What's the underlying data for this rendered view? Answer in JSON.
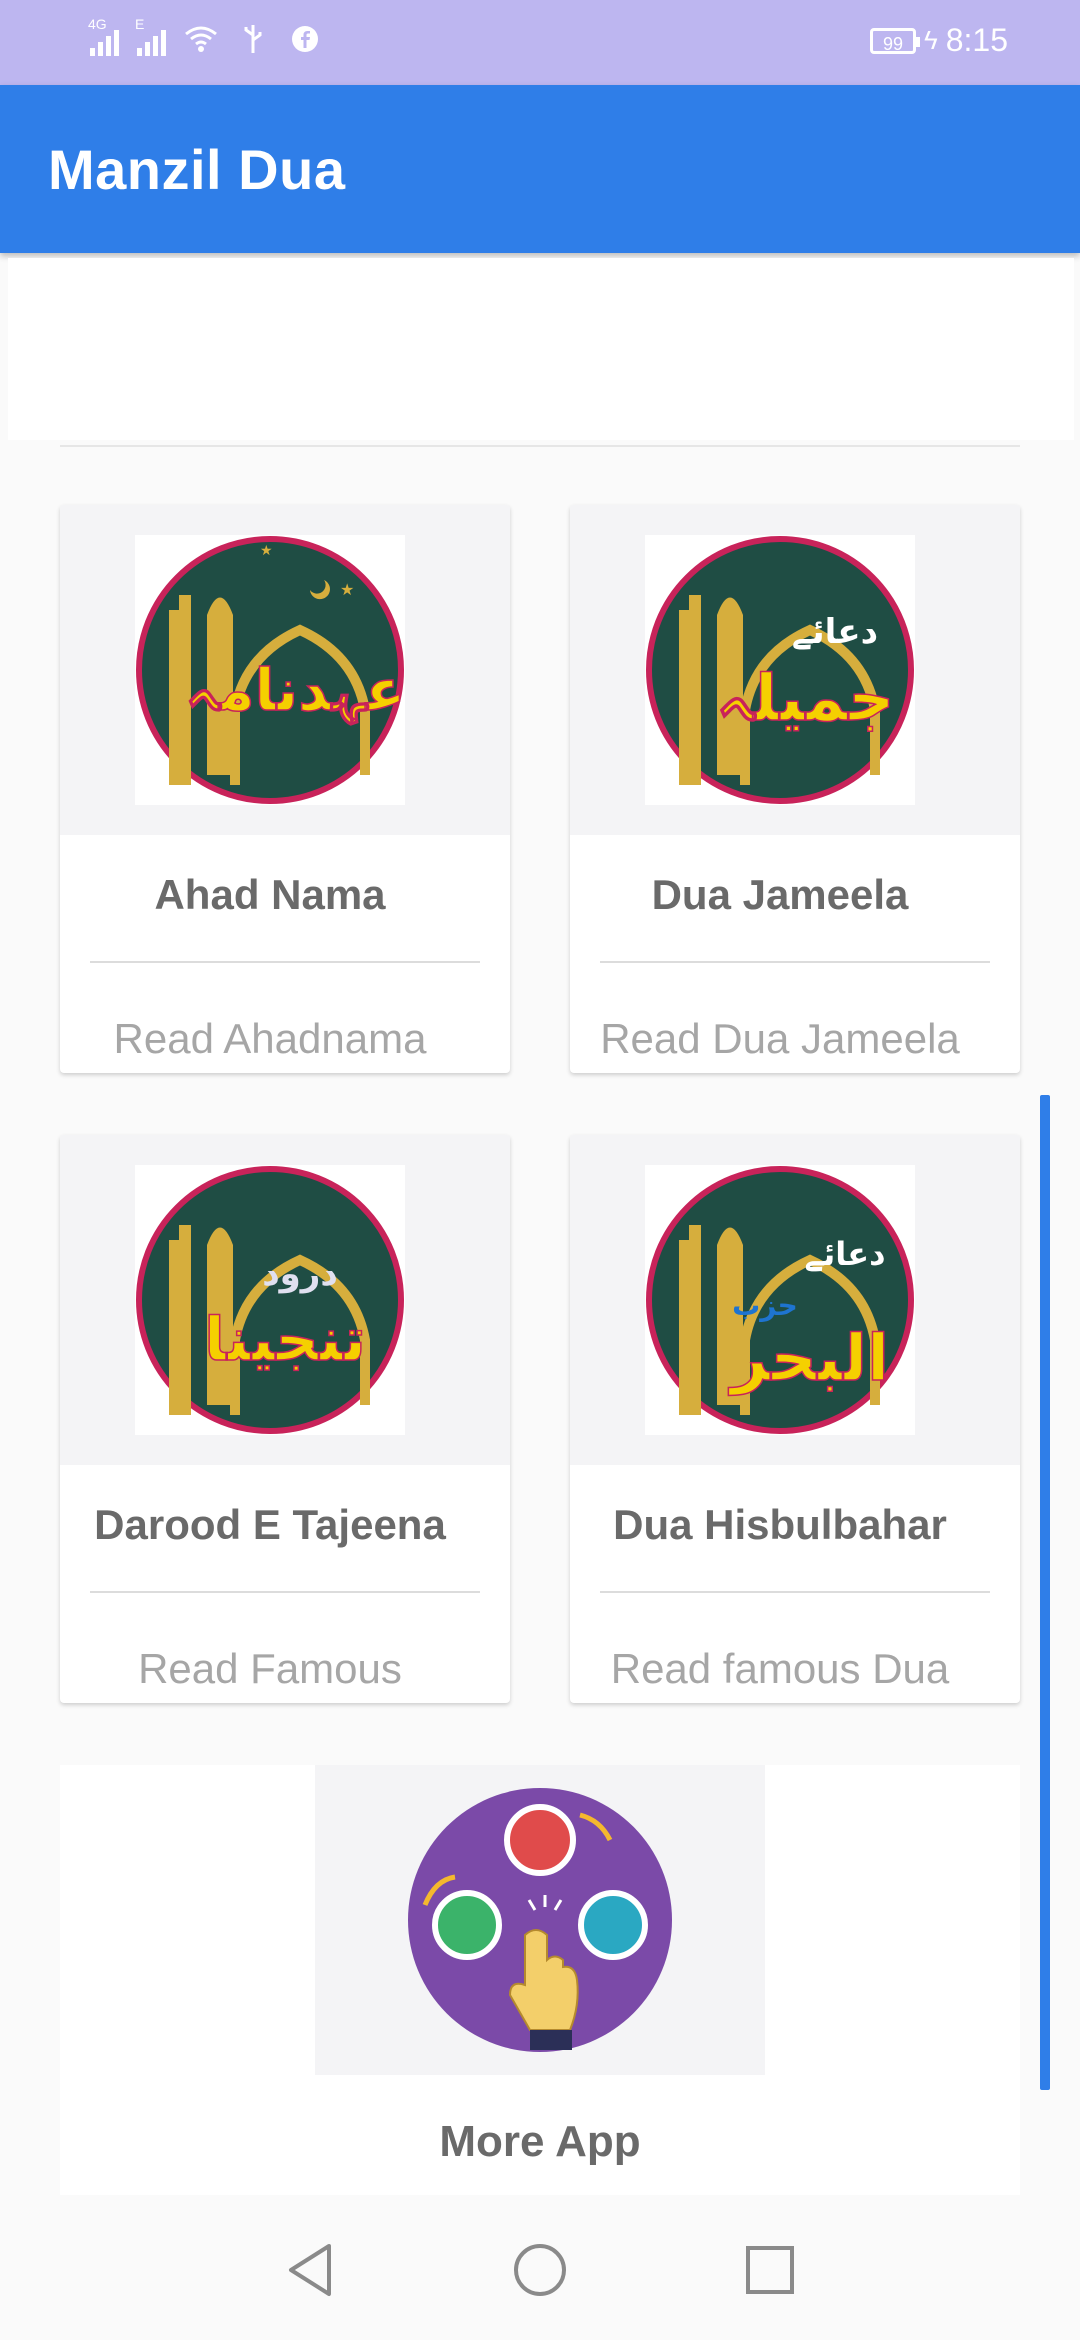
{
  "status_bar": {
    "network1": "4G",
    "network2": "E",
    "battery": "99",
    "time": "8:15",
    "icons": [
      "signal-icon",
      "signal-icon",
      "wifi-icon",
      "usb-icon",
      "facebook-icon",
      "battery-icon",
      "charging-icon"
    ]
  },
  "app_bar": {
    "title": "Manzil Dua"
  },
  "cards": [
    {
      "title": "Ahad Nama",
      "subtitle": "Read Ahadnama",
      "badge_text": "عہدنامہ",
      "badge_color": "#f5d000"
    },
    {
      "title": "Dua Jameela",
      "subtitle": "Read Dua Jameela",
      "badge_text": "جمیلہ",
      "badge_top": "دعائے",
      "badge_color": "#f5d000"
    },
    {
      "title": "Darood E Tajeena",
      "subtitle": "Read Famous",
      "badge_text": "تنجینا",
      "badge_top": "درود",
      "badge_color": "#f5d000"
    },
    {
      "title": "Dua Hisbulbahar",
      "subtitle": "Read famous Dua",
      "badge_text": "البحر",
      "badge_top": "دعائے حزب",
      "badge_color": "#f5d000"
    }
  ],
  "more_app": {
    "title": "More App"
  },
  "colors": {
    "status_bar": "#bdb6f0",
    "app_bar": "#2f7ee8",
    "badge_bg": "#1f4d44",
    "badge_ring": "#c8235a",
    "mosque_gold": "#d6ae3d",
    "more_bg": "#7b4aa8"
  },
  "nav_bar": {
    "icons": [
      "back-icon",
      "home-icon",
      "recents-icon"
    ]
  }
}
